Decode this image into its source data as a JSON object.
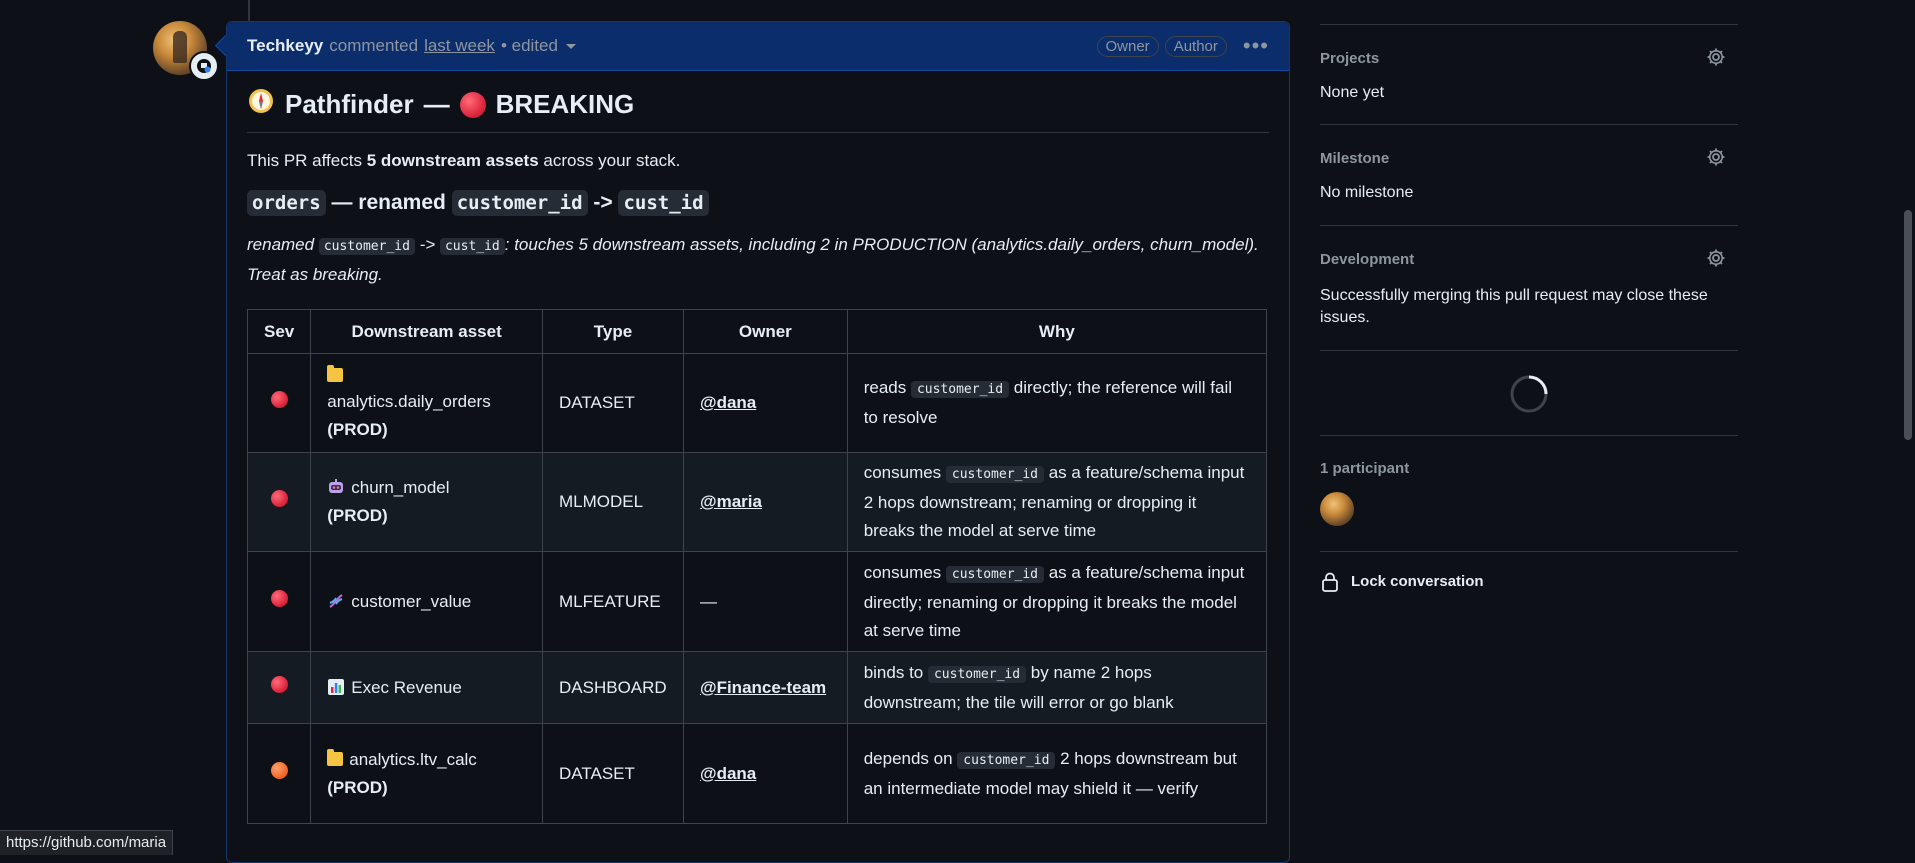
{
  "comment": {
    "author": "Techkeyy",
    "action": "commented",
    "time": "last week",
    "edited": "• edited",
    "badges": [
      "Owner",
      "Author"
    ]
  },
  "heading": {
    "name": "Pathfinder",
    "separator": "—",
    "status": "BREAKING"
  },
  "intro": {
    "prefix": "This PR affects ",
    "count": "5 downstream assets",
    "suffix": " across your stack."
  },
  "change": {
    "table": "orders",
    "dash": " — renamed ",
    "old_col": "customer_id",
    "arrow": " -> ",
    "new_col": "cust_id"
  },
  "summary": {
    "lead": "renamed ",
    "old_col": "customer_id",
    "arrow": " -> ",
    "new_col": "cust_id",
    "rest": ": touches 5 downstream assets, including 2 in PRODUCTION (analytics.daily_orders, churn_model). Treat as breaking."
  },
  "table": {
    "headers": [
      "Sev",
      "Downstream asset",
      "Type",
      "Owner",
      "Why"
    ],
    "rows": [
      {
        "sev": "red",
        "icon": "folder-icon",
        "asset": "analytics.daily_orders",
        "prod": "(PROD)",
        "type": "DATASET",
        "owner": "@dana",
        "why_pre": "reads ",
        "why_code": "customer_id",
        "why_post": " directly; the reference will fail to resolve"
      },
      {
        "sev": "red",
        "icon": "robot-icon",
        "asset": "churn_model",
        "prod": "(PROD)",
        "type": "MLMODEL",
        "owner": "@maria",
        "why_pre": "consumes ",
        "why_code": "customer_id",
        "why_post": " as a feature/schema input 2 hops downstream; renaming or dropping it breaks the model at serve time"
      },
      {
        "sev": "red",
        "icon": "dna-icon",
        "asset": "customer_value",
        "prod": "",
        "type": "MLFEATURE",
        "owner": "—",
        "why_pre": "consumes ",
        "why_code": "customer_id",
        "why_post": " as a feature/schema input directly; renaming or dropping it breaks the model at serve time"
      },
      {
        "sev": "red",
        "icon": "bar-chart-icon",
        "asset": "Exec Revenue",
        "prod": "",
        "type": "DASHBOARD",
        "owner": "@Finance-team",
        "why_pre": "binds to ",
        "why_code": "customer_id",
        "why_post": " by name 2 hops downstream; the tile will error or go blank"
      },
      {
        "sev": "orange",
        "icon": "folder-icon",
        "asset": "analytics.ltv_calc",
        "prod": "(PROD)",
        "type": "DATASET",
        "owner": "@dana",
        "why_pre": "depends on ",
        "why_code": "customer_id",
        "why_post": " 2 hops downstream but an intermediate model may shield it — verify"
      }
    ]
  },
  "sidebar": {
    "projects": {
      "label": "Projects",
      "value": "None yet"
    },
    "milestone": {
      "label": "Milestone",
      "value": "No milestone"
    },
    "development": {
      "label": "Development",
      "value": "Successfully merging this pull request may close these issues."
    },
    "participants": {
      "label": "1 participant"
    },
    "lock": {
      "label": "Lock conversation"
    }
  },
  "status_bar": {
    "url": "https://github.com/maria"
  },
  "colors": {
    "sev_red": "#e0283f",
    "sev_orange": "#f26a2e",
    "header_bg": "#0c2d6b",
    "page_bg": "#0d1117"
  }
}
